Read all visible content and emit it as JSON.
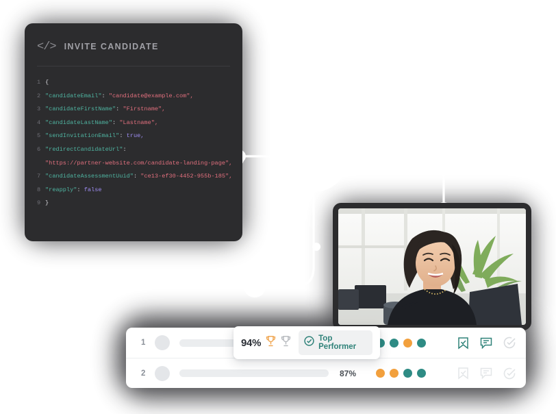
{
  "code_card": {
    "icon": "code-tag-icon",
    "title": "INVITE CANDIDATE",
    "lines": [
      {
        "n": "1",
        "tokens": [
          {
            "t": "{",
            "c": "p"
          }
        ]
      },
      {
        "n": "2",
        "tokens": [
          {
            "t": "\"candidateEmail\"",
            "c": "k"
          },
          {
            "t": ": ",
            "c": "p"
          },
          {
            "t": "\"candidate@example.com\",",
            "c": "s"
          }
        ]
      },
      {
        "n": "3",
        "tokens": [
          {
            "t": "\"candidateFirstName\"",
            "c": "k"
          },
          {
            "t": ": ",
            "c": "p"
          },
          {
            "t": "\"Firstname\",",
            "c": "s"
          }
        ]
      },
      {
        "n": "4",
        "tokens": [
          {
            "t": "\"candidateLastName\"",
            "c": "k"
          },
          {
            "t": ": ",
            "c": "p"
          },
          {
            "t": "\"Lastname\",",
            "c": "s"
          }
        ]
      },
      {
        "n": "5",
        "tokens": [
          {
            "t": "\"sendInvitationEmail\"",
            "c": "k"
          },
          {
            "t": ": ",
            "c": "p"
          },
          {
            "t": "true,",
            "c": "b"
          }
        ]
      },
      {
        "n": "6",
        "tokens": [
          {
            "t": "\"redirectCandidateUrl\"",
            "c": "k"
          },
          {
            "t": ":",
            "c": "p"
          }
        ]
      },
      {
        "n": "",
        "tokens": [
          {
            "t": "\"https://partner-website.com/candidate-landing-page\",",
            "c": "s"
          }
        ]
      },
      {
        "n": "7",
        "tokens": [
          {
            "t": "\"candidateAssessmentUuid\"",
            "c": "k"
          },
          {
            "t": ": ",
            "c": "p"
          },
          {
            "t": "\"ce13-ef30-4452-955b-185\",",
            "c": "s"
          }
        ]
      },
      {
        "n": "8",
        "tokens": [
          {
            "t": "\"reapply\"",
            "c": "k"
          },
          {
            "t": ": ",
            "c": "p"
          },
          {
            "t": "false",
            "c": "b"
          }
        ]
      },
      {
        "n": "9",
        "tokens": [
          {
            "t": "}",
            "c": "p"
          }
        ]
      }
    ]
  },
  "photo_card": {
    "alt": "smiling woman at desk in bright office with plants"
  },
  "results": {
    "rows": [
      {
        "rank": "1",
        "score": "94%",
        "dots": [
          "teal",
          "teal",
          "orange",
          "teal"
        ],
        "actions_active": true
      },
      {
        "rank": "2",
        "score": "87%",
        "dots": [
          "orange",
          "orange",
          "teal",
          "teal"
        ],
        "actions_active": false
      }
    ],
    "action_icons": [
      "bookmark-check-icon",
      "comment-icon",
      "check-circle-icon"
    ]
  },
  "popover": {
    "score": "94%",
    "trophies": [
      "trophy-gold-icon",
      "trophy-grey-icon"
    ],
    "badge_icon": "check-circle-icon",
    "badge_label": "Top Performer"
  },
  "colors": {
    "teal": "#2e8b84",
    "orange": "#f2a03d",
    "trophy_gold": "#f0a856",
    "trophy_grey": "#b9bcc0",
    "badge_text": "#2f8279",
    "card_dark": "#2c2c2e",
    "code_key": "#4fb3a0",
    "code_string": "#e06f7d",
    "code_bool": "#9d8cf0"
  },
  "connectors": {
    "hub": "central-hub-node",
    "nodes": [
      "top-right-node",
      "left-stub-node",
      "right-mid-node",
      "right-elbow-node",
      "bottom-node",
      "bottom-left-node"
    ]
  }
}
